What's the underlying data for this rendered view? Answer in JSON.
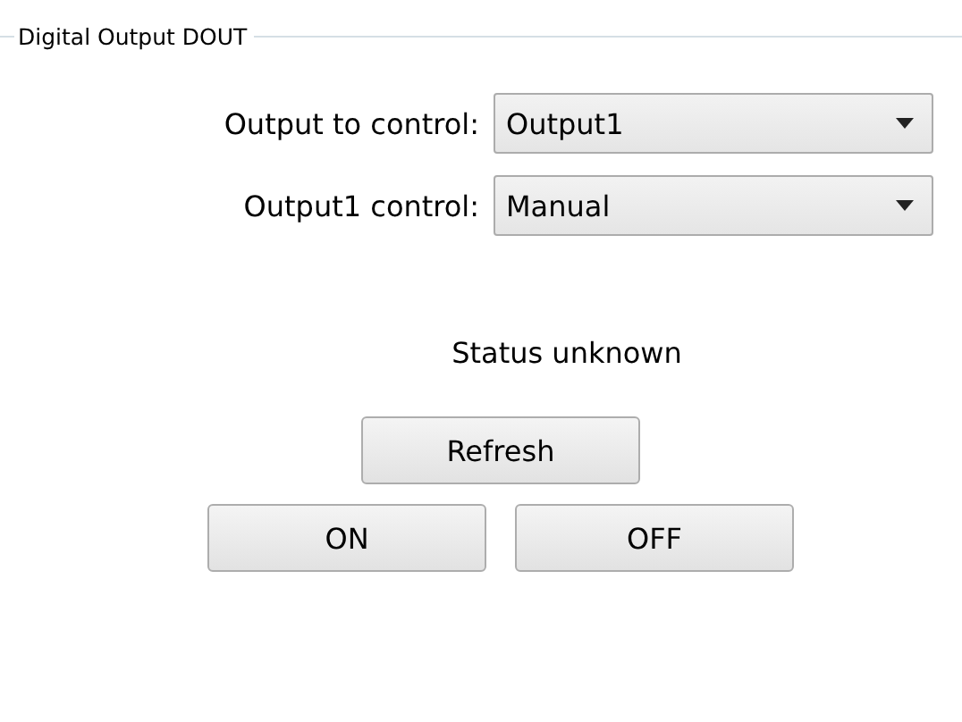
{
  "group": {
    "title": "Digital Output DOUT"
  },
  "fields": [
    {
      "label": "Output to control:",
      "value": "Output1"
    },
    {
      "label": "Output1 control:",
      "value": "Manual"
    }
  ],
  "status": "Status unknown",
  "refresh_button": "Refresh",
  "buttons": [
    "ON",
    "OFF"
  ]
}
